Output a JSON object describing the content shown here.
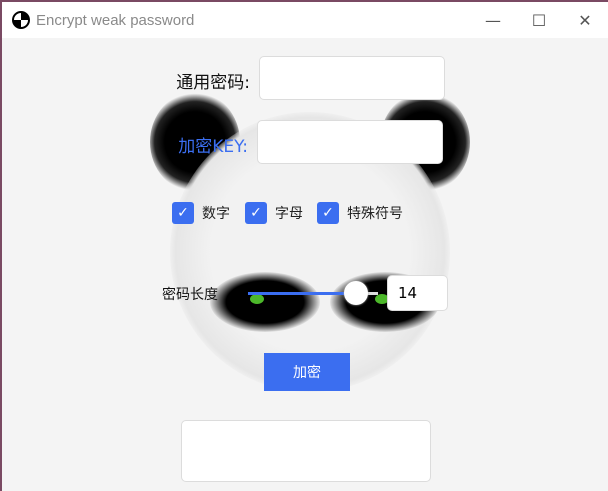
{
  "window": {
    "title": "Encrypt weak password",
    "minimize": "—",
    "maximize": "☐",
    "close": "✕"
  },
  "form": {
    "password_label": "通用密码:",
    "password_value": "",
    "key_label": "加密KEY:",
    "key_value": "",
    "checkboxes": [
      {
        "label": "数字",
        "checked": true
      },
      {
        "label": "字母",
        "checked": true
      },
      {
        "label": "特殊符号",
        "checked": true
      }
    ],
    "length_label": "密码长度",
    "length_value": "14",
    "slider_fraction": 0.83,
    "encrypt_button": "加密",
    "output_value": ""
  },
  "colors": {
    "accent": "#3b6ef0"
  }
}
